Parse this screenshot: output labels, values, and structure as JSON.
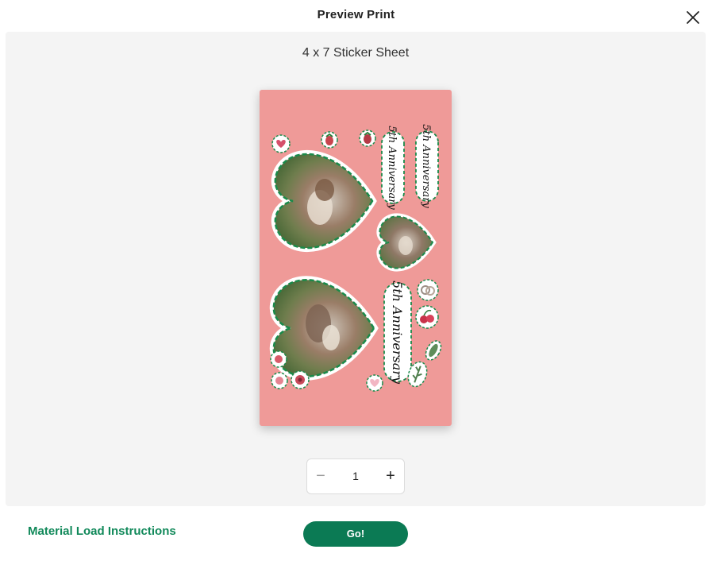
{
  "dialog": {
    "title": "Preview Print",
    "close_icon": "close-icon"
  },
  "preview": {
    "sheet_label": "4 x 7 Sticker Sheet",
    "sheet_color": "#ef9a98",
    "stickers": {
      "photo_hearts": 3,
      "text_stickers": [
        "5th Anniversary",
        "5th Anniversary",
        "5th Anniversary"
      ],
      "small_stickers": [
        "heart",
        "strawberry",
        "strawberry",
        "rings",
        "cherries",
        "leaf",
        "leaf",
        "heart",
        "flower",
        "heart"
      ],
      "cut_line_color": "#1a8a4a"
    }
  },
  "stepper": {
    "minus_icon": "minus-icon",
    "value": "1",
    "plus_icon": "plus-icon"
  },
  "footer": {
    "material_link": "Material Load Instructions",
    "go_button": "Go!",
    "accent": "#0b7a54"
  }
}
